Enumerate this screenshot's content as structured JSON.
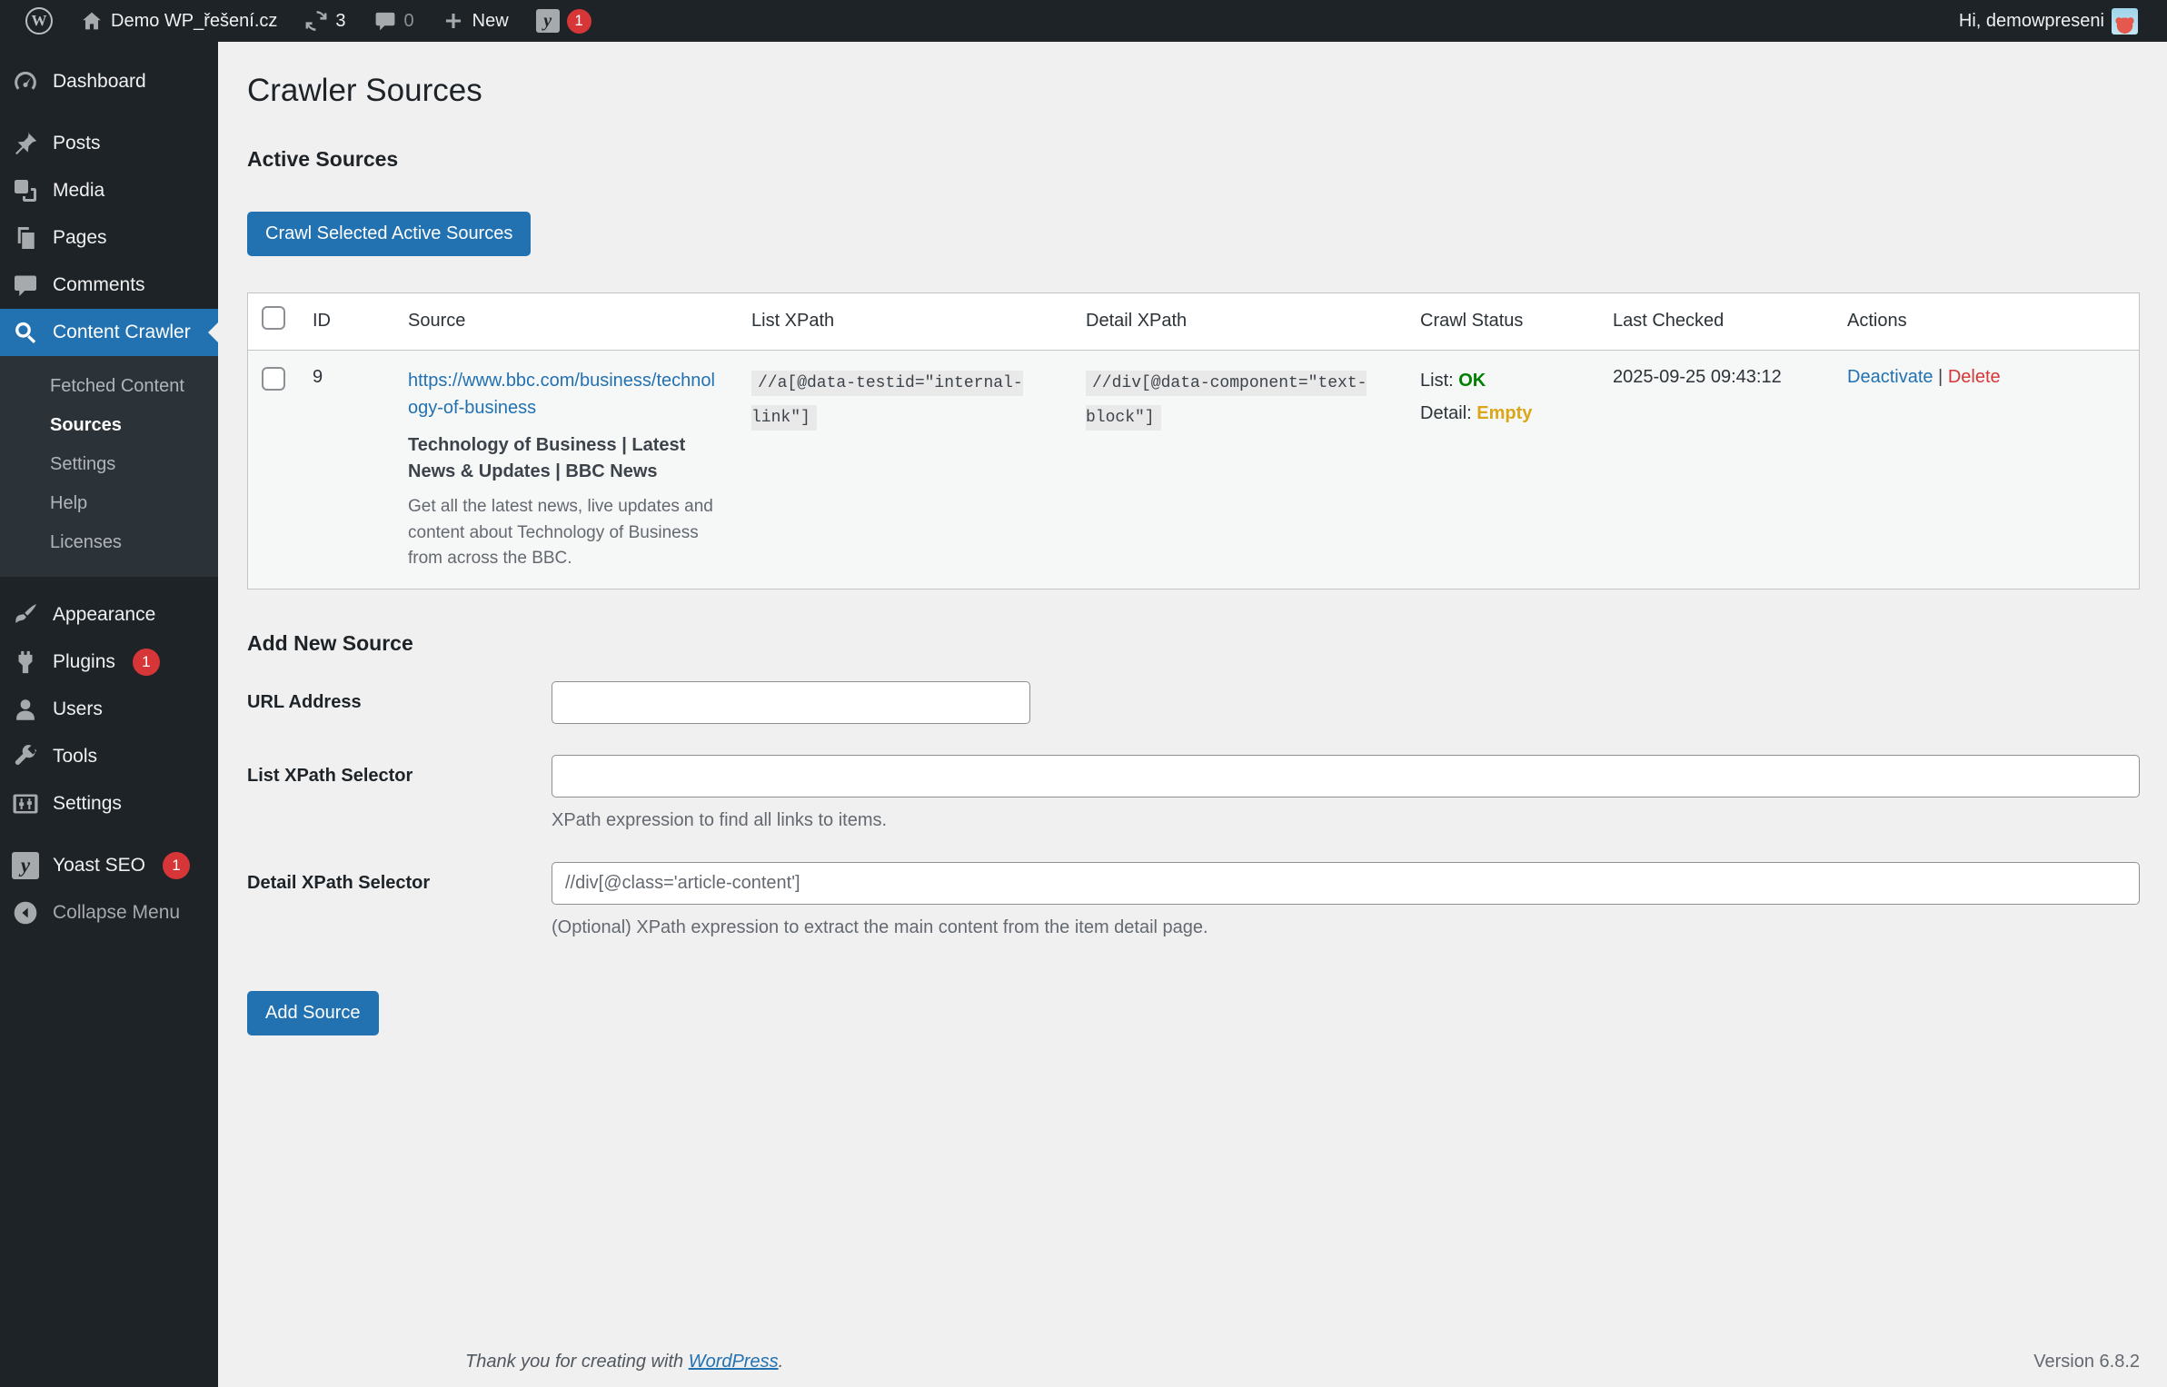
{
  "admin_bar": {
    "site_name": "Demo WP_řešení.cz",
    "updates_count": "3",
    "comments_count": "0",
    "new_label": "New",
    "yoast_badge": "1",
    "greeting": "Hi, demowpreseni"
  },
  "sidebar": {
    "items": [
      {
        "label": "Dashboard"
      },
      {
        "label": "Posts"
      },
      {
        "label": "Media"
      },
      {
        "label": "Pages"
      },
      {
        "label": "Comments"
      },
      {
        "label": "Content Crawler"
      },
      {
        "label": "Appearance"
      },
      {
        "label": "Plugins",
        "badge": "1"
      },
      {
        "label": "Users"
      },
      {
        "label": "Tools"
      },
      {
        "label": "Settings"
      },
      {
        "label": "Yoast SEO",
        "badge": "1"
      },
      {
        "label": "Collapse Menu"
      }
    ],
    "submenu": [
      {
        "label": "Fetched Content"
      },
      {
        "label": "Sources"
      },
      {
        "label": "Settings"
      },
      {
        "label": "Help"
      },
      {
        "label": "Licenses"
      }
    ]
  },
  "main": {
    "page_title": "Crawler Sources",
    "active_sources": {
      "heading": "Active Sources",
      "crawl_button": "Crawl Selected Active Sources",
      "table": {
        "headers": [
          "ID",
          "Source",
          "List XPath",
          "Detail XPath",
          "Crawl Status",
          "Last Checked",
          "Actions"
        ],
        "rows": [
          {
            "id": "9",
            "source_url": "https://www.bbc.com/business/technology-of-business",
            "source_title": "Technology of Business | Latest News & Updates | BBC News",
            "source_description": "Get all the latest news, live updates and content about Technology of Business from across the BBC.",
            "list_xpath": "//a[@data-testid=\"internal-link\"]",
            "detail_xpath": "//div[@data-component=\"text-block\"]",
            "status_list_label": "List: ",
            "status_list_value": "OK",
            "status_detail_label": "Detail: ",
            "status_detail_value": "Empty",
            "last_checked": "2025-09-25 09:43:12",
            "action_deactivate": "Deactivate",
            "action_separator": " | ",
            "action_delete": "Delete"
          }
        ]
      }
    },
    "add_new_source": {
      "heading": "Add New Source",
      "url_label": "URL Address",
      "url_value": "",
      "list_xpath_label": "List XPath Selector",
      "list_xpath_value": "",
      "list_xpath_help": "XPath expression to find all links to items.",
      "detail_xpath_label": "Detail XPath Selector",
      "detail_xpath_placeholder": "//div[@class='article-content']",
      "detail_xpath_help": "(Optional) XPath expression to extract the main content from the item detail page.",
      "add_button": "Add Source"
    }
  },
  "footer": {
    "thanks_prefix": "Thank you for creating with ",
    "wordpress_link": "WordPress",
    "thanks_suffix": ".",
    "version": "Version 6.8.2"
  },
  "colors": {
    "accent_blue": "#2271b1",
    "sidebar_dark": "#1d2327",
    "submenu_dark": "#2c3338",
    "content_bg": "#f0f0f1",
    "status_ok_green": "#008000",
    "status_empty_orange": "#dba617",
    "delete_red": "#d63638"
  }
}
